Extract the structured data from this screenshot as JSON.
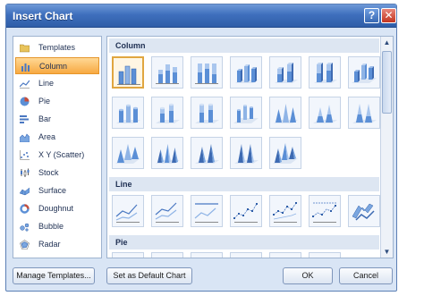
{
  "dialog": {
    "title": "Insert Chart",
    "help_glyph": "?",
    "close_glyph": "✕"
  },
  "categories": [
    {
      "label": "Templates",
      "icon": "folder-icon",
      "selected": false
    },
    {
      "label": "Column",
      "icon": "column-chart-icon",
      "selected": true
    },
    {
      "label": "Line",
      "icon": "line-chart-icon",
      "selected": false
    },
    {
      "label": "Pie",
      "icon": "pie-chart-icon",
      "selected": false
    },
    {
      "label": "Bar",
      "icon": "bar-chart-icon",
      "selected": false
    },
    {
      "label": "Area",
      "icon": "area-chart-icon",
      "selected": false
    },
    {
      "label": "X Y (Scatter)",
      "icon": "scatter-chart-icon",
      "selected": false
    },
    {
      "label": "Stock",
      "icon": "stock-chart-icon",
      "selected": false
    },
    {
      "label": "Surface",
      "icon": "surface-chart-icon",
      "selected": false
    },
    {
      "label": "Doughnut",
      "icon": "doughnut-chart-icon",
      "selected": false
    },
    {
      "label": "Bubble",
      "icon": "bubble-chart-icon",
      "selected": false
    },
    {
      "label": "Radar",
      "icon": "radar-chart-icon",
      "selected": false
    }
  ],
  "sections": {
    "column": "Column",
    "line": "Line",
    "pie": "Pie"
  },
  "buttons": {
    "manage_templates": "Manage Templates...",
    "set_default": "Set as Default Chart",
    "ok": "OK",
    "cancel": "Cancel"
  },
  "colors": {
    "accent": "#3f6fbd",
    "selection": "#f7a942",
    "chart_fill": "#5b8fd6"
  }
}
